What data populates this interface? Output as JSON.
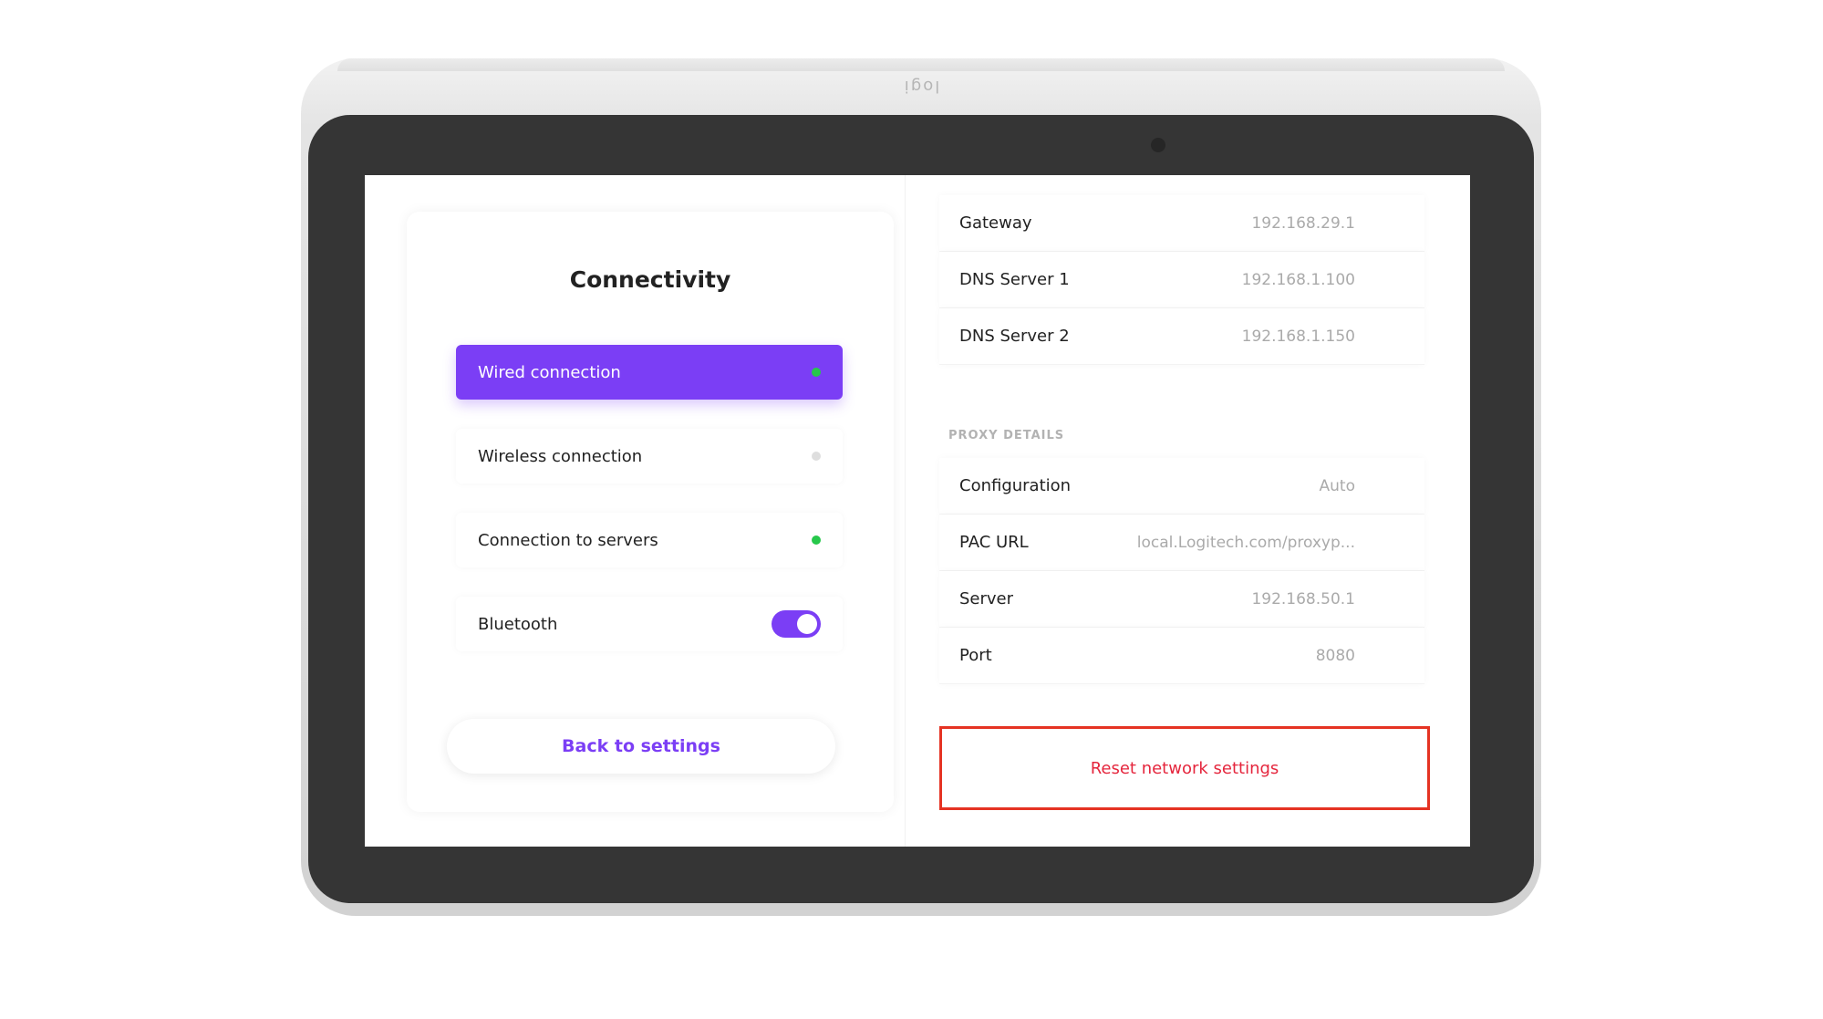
{
  "device": {
    "logo_text": "logi"
  },
  "connectivity": {
    "title": "Connectivity",
    "items": [
      {
        "label": "Wired connection",
        "status": "connected"
      },
      {
        "label": "Wireless connection",
        "status": "disconnected"
      },
      {
        "label": "Connection to servers",
        "status": "connected"
      },
      {
        "label": "Bluetooth",
        "status": "toggle-on"
      }
    ],
    "back_label": "Back to settings"
  },
  "network": {
    "rows": [
      {
        "label": "Gateway",
        "value": "192.168.29.1"
      },
      {
        "label": "DNS Server 1",
        "value": "192.168.1.100"
      },
      {
        "label": "DNS Server 2",
        "value": "192.168.1.150"
      }
    ]
  },
  "proxy": {
    "section_label": "PROXY DETAILS",
    "rows": [
      {
        "label": "Configuration",
        "value": "Auto"
      },
      {
        "label": "PAC URL",
        "value": "local.Logitech.com/proxyp..."
      },
      {
        "label": "Server",
        "value": "192.168.50.1"
      },
      {
        "label": "Port",
        "value": "8080"
      }
    ]
  },
  "reset_label": "Reset network settings",
  "colors": {
    "accent": "#7b3ef5",
    "status_green": "#27c84b",
    "status_grey": "#dedede",
    "highlight_red": "#e53323"
  }
}
